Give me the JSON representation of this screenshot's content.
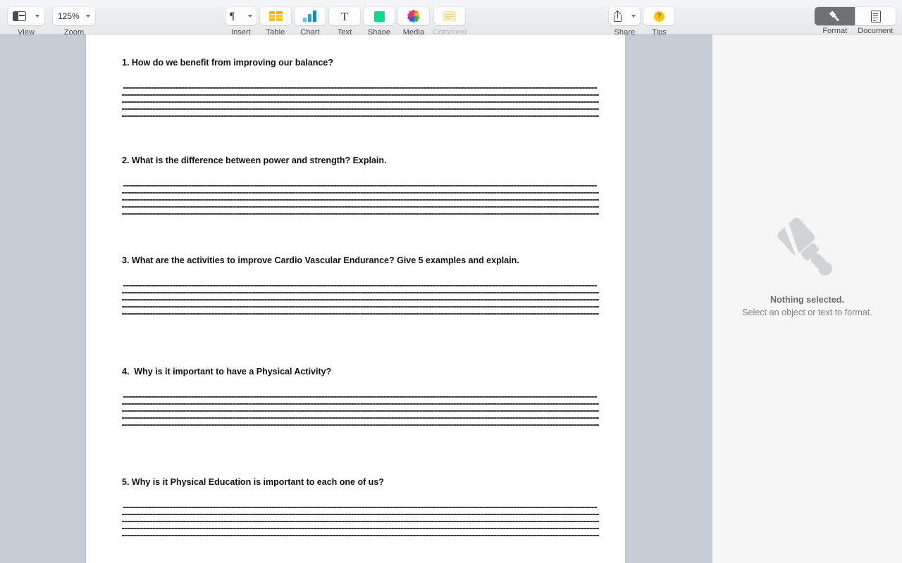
{
  "toolbar": {
    "view": {
      "label": "View",
      "icon": "sidebar-layout-icon"
    },
    "zoom": {
      "label": "Zoom",
      "value": "125%"
    },
    "insert": {
      "label": "Insert",
      "icon": "pilcrow-icon",
      "glyph": "¶"
    },
    "table": {
      "label": "Table",
      "icon": "table-grid-icon"
    },
    "chart": {
      "label": "Chart",
      "icon": "bar-chart-icon"
    },
    "text": {
      "label": "Text",
      "icon": "text-t-icon",
      "glyph": "T"
    },
    "shape": {
      "label": "Shape",
      "icon": "square-shape-icon"
    },
    "media": {
      "label": "Media",
      "icon": "photos-pinwheel-icon"
    },
    "comment": {
      "label": "Comment",
      "icon": "sticky-note-icon",
      "disabled": true
    },
    "share": {
      "label": "Share",
      "icon": "share-upload-icon"
    },
    "tips": {
      "label": "Tips",
      "icon": "question-mark-icon",
      "glyph": "?"
    },
    "format": {
      "label": "Format",
      "icon": "paintbrush-icon",
      "selected": true
    },
    "document": {
      "label": "Document",
      "icon": "document-page-icon",
      "selected": false
    }
  },
  "sidebar": {
    "empty_state": {
      "icon": "paintbrush-icon",
      "title": "Nothing selected.",
      "subtitle": "Select an object or text to format."
    }
  },
  "document": {
    "questions": [
      {
        "text": "1. How do we benefit from improving our balance?",
        "lines": 5
      },
      {
        "text": "2. What is the difference between power and strength? Explain.",
        "lines": 5
      },
      {
        "text": "3. What are the activities to improve Cardio Vascular Endurance? Give 5 examples and explain.",
        "lines": 5
      },
      {
        "text": "4.  Why is it important to have a Physical Activity?",
        "lines": 5
      },
      {
        "text": "5. Why is it Physical Education is important to each one of us?",
        "lines": 5
      }
    ]
  },
  "colors": {
    "canvas_background": "#c5ccd5",
    "page_background": "#ffffff",
    "toolbar_background": "#ebedf0",
    "sidebar_background": "#f6f6f6",
    "table_icon": "#f5c518",
    "chart_icon": "#1487cc",
    "shape_icon": "#12d88e",
    "tips_icon": "#fdc614",
    "format_selected": "#6f7174"
  }
}
